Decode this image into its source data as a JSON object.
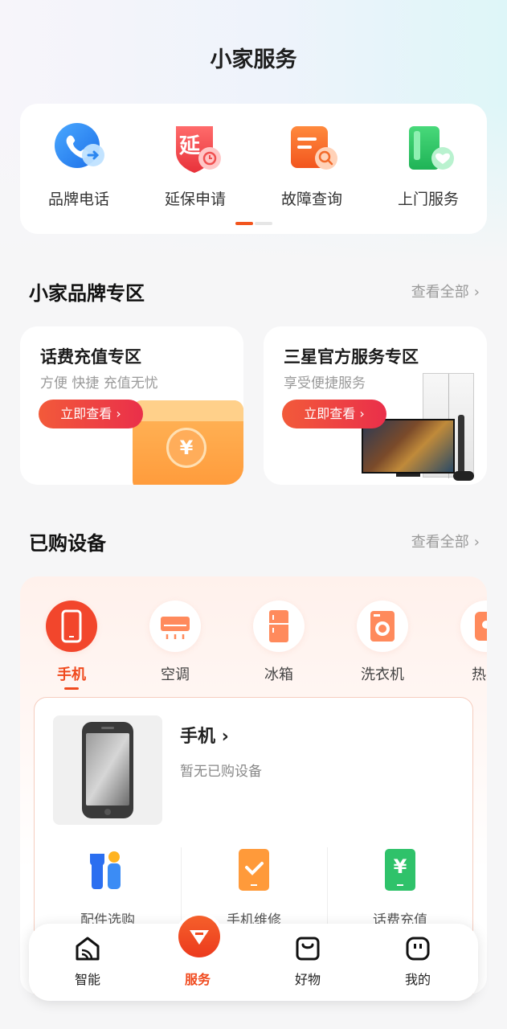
{
  "page": {
    "title": "小家服务"
  },
  "quick_services": [
    {
      "label": "品牌电话",
      "icon": "phone-icon"
    },
    {
      "label": "延保申请",
      "icon": "extended-warranty-icon",
      "glyph": "延"
    },
    {
      "label": "故障查询",
      "icon": "fault-query-icon"
    },
    {
      "label": "上门服务",
      "icon": "home-service-icon"
    }
  ],
  "brand_zone": {
    "title": "小家品牌专区",
    "see_all": "查看全部",
    "cards": [
      {
        "title": "话费充值专区",
        "subtitle": "方便 快捷 充值无忧",
        "button": "立即查看",
        "coin": "¥"
      },
      {
        "title": "三星官方服务专区",
        "subtitle": "享受便捷服务",
        "button": "立即查看"
      }
    ]
  },
  "purchased": {
    "title": "已购设备",
    "see_all": "查看全部",
    "tabs": [
      {
        "label": "手机",
        "icon": "phone-device-icon",
        "active": true
      },
      {
        "label": "空调",
        "icon": "air-conditioner-icon"
      },
      {
        "label": "冰箱",
        "icon": "fridge-icon"
      },
      {
        "label": "洗衣机",
        "icon": "washing-machine-icon"
      },
      {
        "label": "热水",
        "icon": "water-heater-icon"
      }
    ],
    "device": {
      "name": "手机",
      "empty": "暂无已购设备"
    },
    "services": [
      {
        "label": "配件选购",
        "icon": "accessories-icon"
      },
      {
        "label": "手机维修",
        "icon": "phone-repair-icon"
      },
      {
        "label": "话费充值",
        "icon": "phone-recharge-icon",
        "glyph": "¥"
      }
    ]
  },
  "nav": [
    {
      "label": "智能",
      "icon": "smart-home-icon"
    },
    {
      "label": "服务",
      "icon": "service-icon",
      "active": true
    },
    {
      "label": "好物",
      "icon": "shop-bag-icon"
    },
    {
      "label": "我的",
      "icon": "profile-icon"
    }
  ],
  "colors": {
    "accent": "#f04a1e",
    "button": "#ea2f4a",
    "recharge": "#2fc26a",
    "blue": "#2b86f0"
  }
}
